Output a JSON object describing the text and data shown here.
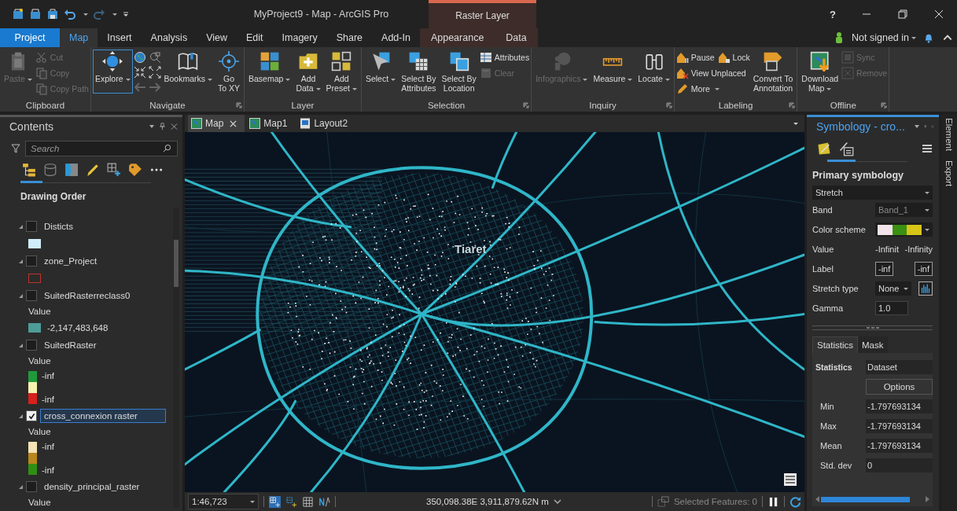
{
  "title_bar": {
    "title": "MyProject9 - Map - ArcGIS Pro",
    "context_tab": "Raster Layer",
    "help": "?"
  },
  "tabs": [
    {
      "label": "Project",
      "kind": "backstage",
      "selected": false
    },
    {
      "label": "Map",
      "kind": "core",
      "selected": true
    },
    {
      "label": "Insert",
      "kind": "core",
      "selected": false
    },
    {
      "label": "Analysis",
      "kind": "core",
      "selected": false
    },
    {
      "label": "View",
      "kind": "core",
      "selected": false
    },
    {
      "label": "Edit",
      "kind": "core",
      "selected": false
    },
    {
      "label": "Imagery",
      "kind": "core",
      "selected": false
    },
    {
      "label": "Share",
      "kind": "core",
      "selected": false
    },
    {
      "label": "Add-In",
      "kind": "core",
      "selected": false
    },
    {
      "label": "Appearance",
      "kind": "context",
      "selected": false
    },
    {
      "label": "Data",
      "kind": "context",
      "selected": false
    }
  ],
  "account": {
    "label": "Not signed in"
  },
  "ribbon": [
    {
      "label": "Clipboard",
      "launcher": false,
      "items": [
        {
          "kind": "large",
          "label": "Paste",
          "disabled": true,
          "selected": false,
          "menu": true
        },
        {
          "kind": "stack",
          "rows": [
            [
              {
                "label": "Cut",
                "disabled": true,
                "menu": false
              }
            ],
            [
              {
                "label": "Copy",
                "disabled": true,
                "menu": false
              }
            ],
            [
              {
                "label": "Copy Path",
                "disabled": true,
                "menu": false
              }
            ]
          ]
        }
      ]
    },
    {
      "label": "Navigate",
      "launcher": true,
      "items": [
        {
          "kind": "large",
          "label": "Explore",
          "disabled": false,
          "selected": true,
          "menu": true
        },
        {
          "kind": "nav_tools"
        },
        {
          "kind": "large",
          "label": "Bookmarks",
          "disabled": false,
          "selected": false,
          "menu": true
        },
        {
          "kind": "large",
          "label": "Go\nTo XY",
          "disabled": false,
          "selected": false,
          "menu": false
        }
      ]
    },
    {
      "label": "Layer",
      "launcher": false,
      "items": [
        {
          "kind": "large",
          "label": "Basemap",
          "disabled": false,
          "selected": false,
          "menu": true
        },
        {
          "kind": "large",
          "label": "Add\nData",
          "disabled": false,
          "selected": false,
          "menu": true
        },
        {
          "kind": "large",
          "label": "Add\nPreset",
          "disabled": false,
          "selected": false,
          "menu": true
        }
      ]
    },
    {
      "label": "Selection",
      "launcher": true,
      "items": [
        {
          "kind": "large",
          "label": "Select",
          "disabled": false,
          "selected": false,
          "menu": true
        },
        {
          "kind": "large",
          "label": "Select By\nAttributes",
          "disabled": false,
          "selected": false,
          "menu": false
        },
        {
          "kind": "large",
          "label": "Select By\nLocation",
          "disabled": false,
          "selected": false,
          "menu": false
        },
        {
          "kind": "stack",
          "rows": [
            [
              {
                "label": "Attributes",
                "disabled": false,
                "menu": false
              }
            ],
            [
              {
                "label": "Clear",
                "disabled": true,
                "menu": false
              }
            ]
          ]
        }
      ]
    },
    {
      "label": "Inquiry",
      "launcher": true,
      "items": [
        {
          "kind": "large",
          "label": "Infographics",
          "disabled": true,
          "selected": false,
          "menu": true
        },
        {
          "kind": "large",
          "label": "Measure",
          "disabled": false,
          "selected": false,
          "menu": true
        },
        {
          "kind": "large",
          "label": "Locate",
          "disabled": false,
          "selected": false,
          "menu": true
        }
      ]
    },
    {
      "label": "Labeling",
      "launcher": true,
      "items": [
        {
          "kind": "stack",
          "rows": [
            [
              {
                "label": "Pause",
                "disabled": false,
                "menu": false
              },
              {
                "label": "Lock",
                "disabled": false,
                "menu": false
              }
            ],
            [
              {
                "label": "View Unplaced",
                "disabled": false,
                "menu": false
              }
            ],
            [
              {
                "label": "More",
                "disabled": false,
                "menu": true
              }
            ]
          ]
        },
        {
          "kind": "large",
          "label": "Convert To\nAnnotation",
          "disabled": false,
          "selected": false,
          "menu": false
        }
      ]
    },
    {
      "label": "Offline",
      "launcher": true,
      "items": [
        {
          "kind": "large",
          "label": "Download\nMap",
          "disabled": false,
          "selected": false,
          "menu": true
        },
        {
          "kind": "stack",
          "rows": [
            [
              {
                "label": "Sync",
                "disabled": true,
                "menu": false
              }
            ],
            [
              {
                "label": "Remove",
                "disabled": true,
                "menu": false
              }
            ]
          ]
        }
      ]
    }
  ],
  "contents": {
    "title": "Contents",
    "search": {
      "placeholder": "Search"
    },
    "heading": "Drawing Order",
    "layers": [
      {
        "name": "Disticts",
        "expanded": true,
        "checked": false,
        "selected": false,
        "legend": {
          "kind": "fill",
          "color": "#cfeefa"
        }
      },
      {
        "name": "zone_Project",
        "expanded": true,
        "checked": false,
        "selected": false,
        "legend": {
          "kind": "outline",
          "color": "#c0312b"
        }
      },
      {
        "name": "SuitedRasterreclass0",
        "expanded": true,
        "checked": false,
        "selected": false,
        "legend": {
          "heading": "Value",
          "kind": "class",
          "color": "#4e9c98",
          "labels": [
            "-2,147,483,648"
          ]
        }
      },
      {
        "name": "SuitedRaster",
        "expanded": true,
        "checked": false,
        "selected": false,
        "legend": {
          "heading": "Value",
          "kind": "ramp",
          "stops": [
            {
              "color": "#1f9a3a"
            },
            {
              "color": "#f6f3b0"
            },
            {
              "color": "#d8201c"
            }
          ],
          "labels": [
            "-inf",
            "-inf"
          ]
        }
      },
      {
        "name": "cross_connexion raster",
        "expanded": true,
        "checked": true,
        "selected": true,
        "legend": {
          "heading": "Value",
          "kind": "ramp",
          "stops": [
            {
              "color": "#f3e3b6"
            },
            {
              "color": "#b8861c"
            },
            {
              "color": "#2f8f12"
            }
          ],
          "labels": [
            "-inf",
            "-inf"
          ]
        }
      },
      {
        "name": "density_principal_raster",
        "expanded": true,
        "checked": false,
        "selected": false,
        "legend": {
          "heading": "Value"
        }
      }
    ]
  },
  "map_tabs": [
    {
      "label": "Map",
      "kind": "map",
      "selected": true
    },
    {
      "label": "Map1",
      "kind": "map",
      "selected": false
    },
    {
      "label": "Layout2",
      "kind": "layout",
      "selected": false
    }
  ],
  "map": {
    "place_label": "Tiaret"
  },
  "status_bar": {
    "scale": "1:46,723",
    "coordinates": "350,098.38E 3,911,879.62N m",
    "selected_features": "Selected Features: 0"
  },
  "symbology": {
    "title": "Symbology - cro...",
    "heading": "Primary symbology",
    "method": "Stretch",
    "rows": [
      {
        "label": "Band",
        "kind": "dropdown",
        "value": "Band_1",
        "disabled": true
      },
      {
        "label": "Color scheme",
        "kind": "ramp",
        "stops": [
          {
            "color": "#f3e3ea"
          },
          {
            "color": "#3a9012"
          },
          {
            "color": "#d8c418"
          }
        ]
      },
      {
        "label": "Value",
        "kind": "pair",
        "values": [
          "-Infinit",
          "-Infinity"
        ]
      },
      {
        "label": "Label",
        "kind": "inputs",
        "values": [
          "-inf",
          "-inf"
        ]
      },
      {
        "label": "Stretch type",
        "kind": "dropdown_button",
        "value": "None",
        "disabled": false
      },
      {
        "label": "Gamma",
        "kind": "input",
        "value": "1.0"
      }
    ],
    "tabs": [
      {
        "label": "Statistics",
        "selected": true
      },
      {
        "label": "Mask",
        "selected": false
      }
    ],
    "stats": {
      "label": "Statistics",
      "value": "Dataset",
      "button": "Options",
      "rows": [
        {
          "label": "Min",
          "value": "-1.797693134"
        },
        {
          "label": "Max",
          "value": "-1.797693134"
        },
        {
          "label": "Mean",
          "value": "-1.797693134"
        },
        {
          "label": "Std. dev",
          "value": "0"
        }
      ]
    }
  },
  "side_tabs": [
    "Element",
    "Export"
  ]
}
